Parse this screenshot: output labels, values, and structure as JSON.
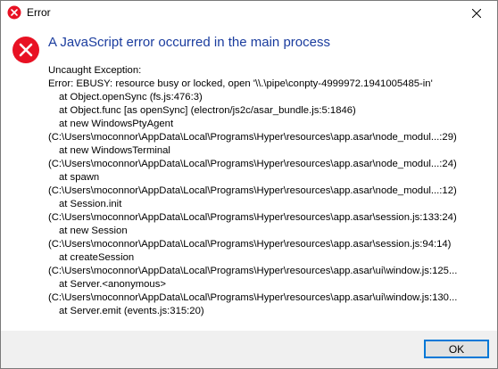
{
  "window": {
    "title": "Error",
    "title_icon": "error-icon",
    "close_icon": "close-icon"
  },
  "dialog": {
    "icon": "error-icon",
    "accent_color": "#1a3c9e",
    "icon_color": "#e81123",
    "heading": "A JavaScript error occurred in the main process",
    "message_lines": [
      {
        "text": "Uncaught Exception:",
        "indent": false
      },
      {
        "text": "Error: EBUSY: resource busy or locked, open '\\\\.\\pipe\\conpty-4999972.1941005485-in'",
        "indent": false
      },
      {
        "text": "at Object.openSync (fs.js:476:3)",
        "indent": true
      },
      {
        "text": "at Object.func [as openSync] (electron/js2c/asar_bundle.js:5:1846)",
        "indent": true
      },
      {
        "text": "at new WindowsPtyAgent",
        "indent": true
      },
      {
        "text": "(C:\\Users\\moconnor\\AppData\\Local\\Programs\\Hyper\\resources\\app.asar\\node_modul...:29)",
        "indent": false
      },
      {
        "text": "at new WindowsTerminal",
        "indent": true
      },
      {
        "text": "(C:\\Users\\moconnor\\AppData\\Local\\Programs\\Hyper\\resources\\app.asar\\node_modul...:24)",
        "indent": false
      },
      {
        "text": "at spawn",
        "indent": true
      },
      {
        "text": "(C:\\Users\\moconnor\\AppData\\Local\\Programs\\Hyper\\resources\\app.asar\\node_modul...:12)",
        "indent": false
      },
      {
        "text": "at Session.init",
        "indent": true
      },
      {
        "text": "(C:\\Users\\moconnor\\AppData\\Local\\Programs\\Hyper\\resources\\app.asar\\session.js:133:24)",
        "indent": false
      },
      {
        "text": "at new Session",
        "indent": true
      },
      {
        "text": "(C:\\Users\\moconnor\\AppData\\Local\\Programs\\Hyper\\resources\\app.asar\\session.js:94:14)",
        "indent": false
      },
      {
        "text": "at createSession",
        "indent": true
      },
      {
        "text": "(C:\\Users\\moconnor\\AppData\\Local\\Programs\\Hyper\\resources\\app.asar\\ui\\window.js:125...",
        "indent": false
      },
      {
        "text": "at Server.<anonymous>",
        "indent": true
      },
      {
        "text": "(C:\\Users\\moconnor\\AppData\\Local\\Programs\\Hyper\\resources\\app.asar\\ui\\window.js:130...",
        "indent": false
      },
      {
        "text": "at Server.emit (events.js:315:20)",
        "indent": true
      }
    ]
  },
  "footer": {
    "ok_label": "OK",
    "ok_border_color": "#0078d7"
  }
}
